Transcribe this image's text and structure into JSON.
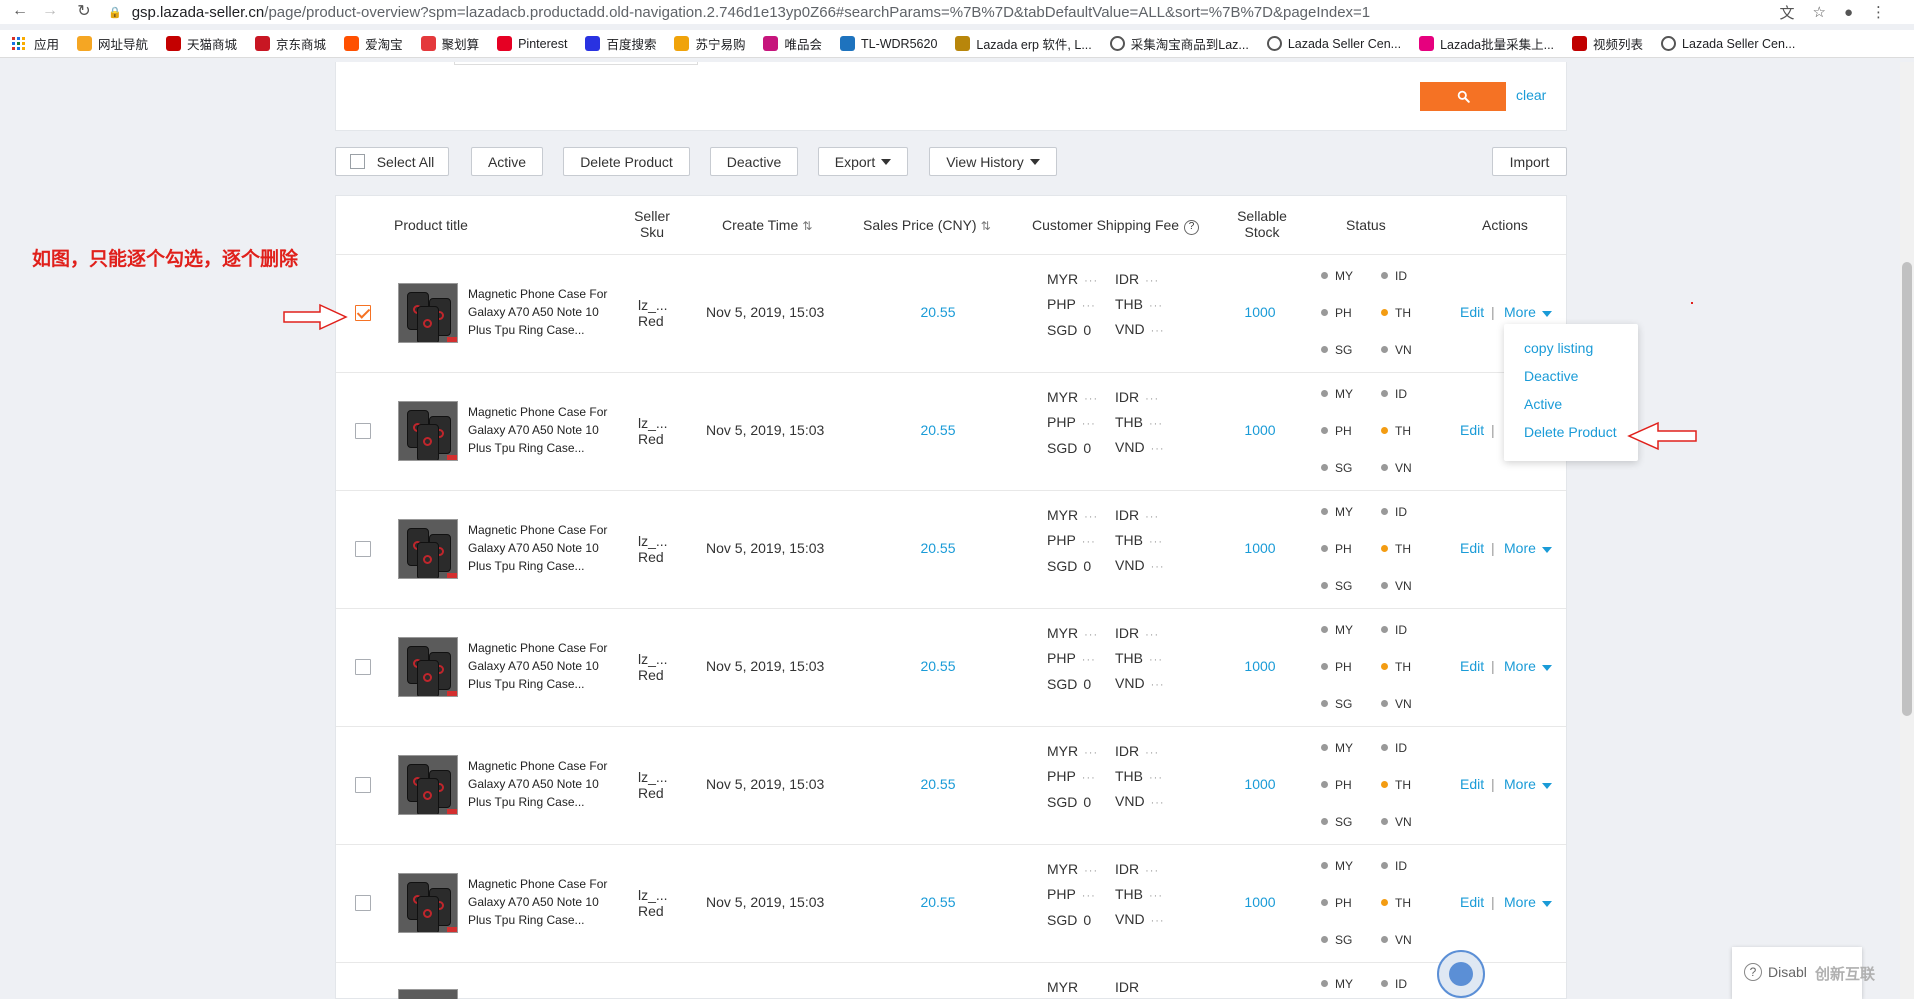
{
  "browser": {
    "url_host": "gsp.lazada-seller.cn",
    "url_path": "/page/product-overview?spm=lazadacb.productadd.old-navigation.2.746d1e13yp0Z66#searchParams=%7B%7D&tabDefaultValue=ALL&sort=%7B%7D&pageIndex=1",
    "bookmarks": [
      {
        "label": "应用",
        "icon": "apps-icon"
      },
      {
        "label": "网址导航",
        "icon": "nav-icon",
        "color": "#f5a623"
      },
      {
        "label": "天猫商城",
        "icon": "tmall-icon",
        "color": "#c40000"
      },
      {
        "label": "京东商城",
        "icon": "jd-icon",
        "color": "#c81623"
      },
      {
        "label": "爱淘宝",
        "icon": "aitaobao-icon",
        "color": "#ff5000"
      },
      {
        "label": "聚划算",
        "icon": "juhuasuan-icon",
        "color": "#e4393c"
      },
      {
        "label": "Pinterest",
        "icon": "pinterest-icon",
        "color": "#e60023"
      },
      {
        "label": "百度搜索",
        "icon": "baidu-icon",
        "color": "#2932e1"
      },
      {
        "label": "苏宁易购",
        "icon": "suning-icon",
        "color": "#f0a30a"
      },
      {
        "label": "唯品会",
        "icon": "vip-icon",
        "color": "#c6157c"
      },
      {
        "label": "TL-WDR5620",
        "icon": "tplink-icon",
        "color": "#1e73be"
      },
      {
        "label": "Lazada erp 软件, L...",
        "icon": "lazada-erp-icon",
        "color": "#b8860b"
      },
      {
        "label": "采集淘宝商品到Laz...",
        "icon": "globe-icon",
        "color": "#555555"
      },
      {
        "label": "Lazada Seller Cen...",
        "icon": "globe-icon",
        "color": "#555555"
      },
      {
        "label": "Lazada批量采集上...",
        "icon": "lazada-icon",
        "color": "#e6007e"
      },
      {
        "label": "视频列表",
        "icon": "video-icon",
        "color": "#c00000"
      },
      {
        "label": "Lazada Seller Cen...",
        "icon": "globe-icon",
        "color": "#555555"
      }
    ]
  },
  "search": {
    "clear_label": "clear"
  },
  "toolbar": {
    "select_all": "Select All",
    "active": "Active",
    "delete_product": "Delete Product",
    "deactive": "Deactive",
    "export": "Export",
    "view_history": "View History",
    "import": "Import"
  },
  "table": {
    "headers": {
      "product_title": "Product title",
      "seller_sku_1": "Seller",
      "seller_sku_2": "Sku",
      "create_time": "Create Time",
      "sales_price": "Sales Price (CNY)",
      "shipping_fee": "Customer Shipping Fee",
      "sellable_1": "Sellable",
      "sellable_2": "Stock",
      "status": "Status",
      "actions": "Actions"
    },
    "rows": [
      {
        "title": "Magnetic Phone Case For Galaxy A70 A50 Note 10 Plus Tpu Ring Case...",
        "sku_1": "lz_...",
        "sku_2": "Red",
        "create_time": "Nov 5, 2019, 15:03",
        "price": "20.55",
        "stock": "1000",
        "checked": true
      },
      {
        "title": "Magnetic Phone Case For Galaxy A70 A50 Note 10 Plus Tpu Ring Case...",
        "sku_1": "lz_...",
        "sku_2": "Red",
        "create_time": "Nov 5, 2019, 15:03",
        "price": "20.55",
        "stock": "1000",
        "checked": false
      },
      {
        "title": "Magnetic Phone Case For Galaxy A70 A50 Note 10 Plus Tpu Ring Case...",
        "sku_1": "lz_...",
        "sku_2": "Red",
        "create_time": "Nov 5, 2019, 15:03",
        "price": "20.55",
        "stock": "1000",
        "checked": false
      },
      {
        "title": "Magnetic Phone Case For Galaxy A70 A50 Note 10 Plus Tpu Ring Case...",
        "sku_1": "lz_...",
        "sku_2": "Red",
        "create_time": "Nov 5, 2019, 15:03",
        "price": "20.55",
        "stock": "1000",
        "checked": false
      },
      {
        "title": "Magnetic Phone Case For Galaxy A70 A50 Note 10 Plus Tpu Ring Case...",
        "sku_1": "lz_...",
        "sku_2": "Red",
        "create_time": "Nov 5, 2019, 15:03",
        "price": "20.55",
        "stock": "1000",
        "checked": false
      },
      {
        "title": "Magnetic Phone Case For Galaxy A70 A50 Note 10 Plus Tpu Ring Case...",
        "sku_1": "lz_...",
        "sku_2": "Red",
        "create_time": "Nov 5, 2019, 15:03",
        "price": "20.55",
        "stock": "1000",
        "checked": false
      }
    ],
    "partial_row": {
      "fee_first": "MYR",
      "fee_second": "IDR",
      "status_first": "MY",
      "status_second": "ID"
    },
    "fee": {
      "myr": "MYR",
      "php": "PHP",
      "sgd": "SGD",
      "sgd_value": "0",
      "idr": "IDR",
      "thb": "THB",
      "vnd": "VND",
      "dots": "···"
    },
    "status_markets": {
      "my": "MY",
      "id": "ID",
      "ph": "PH",
      "th": "TH",
      "sg": "SG",
      "vn": "VN"
    },
    "actions": {
      "edit": "Edit",
      "more": "More"
    }
  },
  "more_menu": {
    "copy_listing": "copy listing",
    "deactive": "Deactive",
    "active": "Active",
    "delete_product": "Delete Product"
  },
  "annotation": {
    "text": "如图，只能逐个勾选，逐个删除",
    "color": "#e0201b"
  },
  "widgets": {
    "disable_label": "Disabl",
    "watermark": "创新互联"
  },
  "colors": {
    "accent": "#f57224",
    "link": "#1a9bd7",
    "status_active": "#f39c12",
    "status_inactive": "#999999"
  }
}
